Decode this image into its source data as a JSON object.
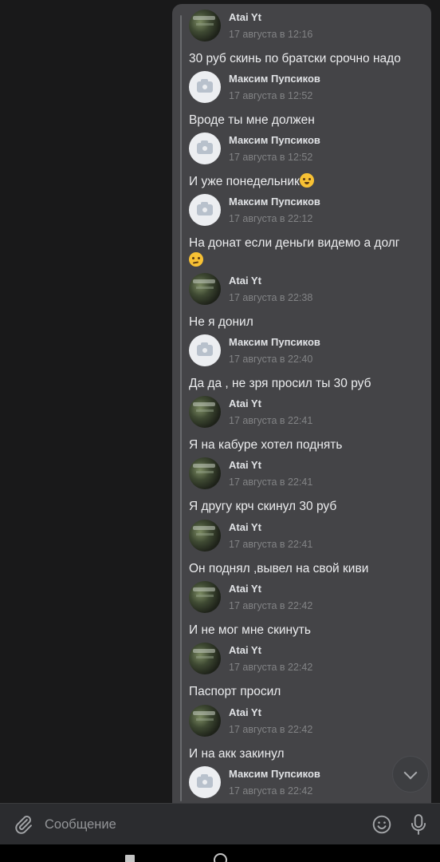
{
  "messages": [
    {
      "avatar": "photo",
      "name": "Atai Yt",
      "time": "17 августа в 12:16",
      "text": "30 руб скинь по братски срочно надо"
    },
    {
      "avatar": "camera",
      "name": "Максим Пупсиков",
      "time": "17 августа в 12:52",
      "text": "Вроде ты мне должен"
    },
    {
      "avatar": "camera",
      "name": "Максим Пупсиков",
      "time": "17 августа в 12:52",
      "text": "И уже понедельник",
      "emoji": "upside-down-face-emoji"
    },
    {
      "avatar": "camera",
      "name": "Максим Пупсиков",
      "time": "17 августа в 22:12",
      "text": "На донат если деньги видемо а долг",
      "emoji": "thinking-face-emoji"
    },
    {
      "avatar": "photo",
      "name": "Atai Yt",
      "time": "17 августа в 22:38",
      "text": "Не я донил"
    },
    {
      "avatar": "camera",
      "name": "Максим Пупсиков",
      "time": "17 августа в 22:40",
      "text": "Да да , не зря просил ты 30 руб"
    },
    {
      "avatar": "photo",
      "name": "Atai Yt",
      "time": "17 августа в 22:41",
      "text": "Я на кабуре хотел поднять"
    },
    {
      "avatar": "photo",
      "name": "Atai Yt",
      "time": "17 августа в 22:41",
      "text": "Я другу крч скинул 30 руб"
    },
    {
      "avatar": "photo",
      "name": "Atai Yt",
      "time": "17 августа в 22:41",
      "text": "Он поднял ,вывел на свой киви"
    },
    {
      "avatar": "photo",
      "name": "Atai Yt",
      "time": "17 августа в 22:42",
      "text": "И не мог мне скинуть"
    },
    {
      "avatar": "photo",
      "name": "Atai Yt",
      "time": "17 августа в 22:42",
      "text": "Паспорт просил"
    },
    {
      "avatar": "photo",
      "name": "Atai Yt",
      "time": "17 августа в 22:42",
      "text": "И на акк закинул"
    },
    {
      "avatar": "camera",
      "name": "Максим Пупсиков",
      "time": "17 августа в 22:42",
      "text": ""
    }
  ],
  "composer": {
    "placeholder": "Сообщение",
    "icons": [
      "paperclip-icon",
      "smile-icon",
      "microphone-icon"
    ]
  },
  "scroll_button_icon": "chevron-down-icon",
  "colors": {
    "background": "#19191a",
    "bubble": "#444447",
    "text": "#ecedef",
    "meta": "#828385",
    "composer": "#2b2c2f"
  }
}
